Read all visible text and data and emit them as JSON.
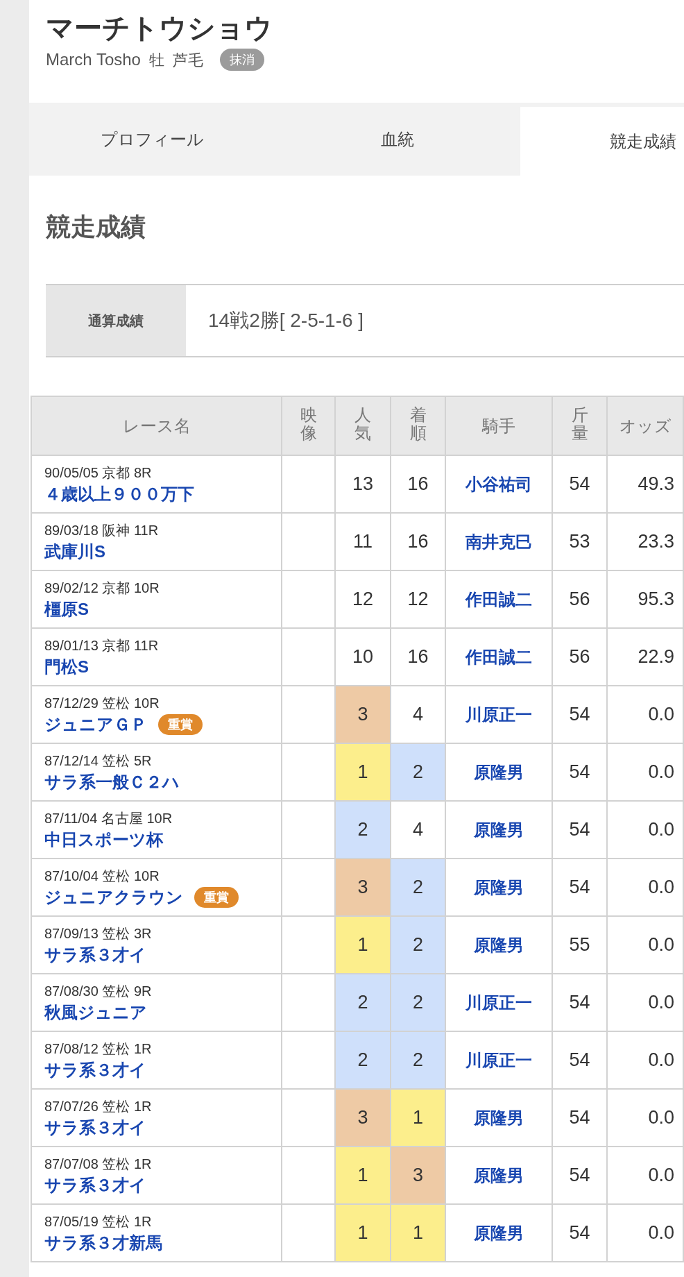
{
  "horse": {
    "name": "マーチトウショウ",
    "english_name": "March Tosho",
    "sex": "牡",
    "coat": "芦毛",
    "status_badge": "抹消"
  },
  "tabs": [
    {
      "label": "プロフィール",
      "selected": false
    },
    {
      "label": "血統",
      "selected": false
    },
    {
      "label": "競走成績",
      "selected": true
    }
  ],
  "section_title": "競走成績",
  "summary": {
    "label": "通算成績",
    "value": "14戦2勝[ 2-5-1-6 ]"
  },
  "table": {
    "columns": [
      {
        "label": "レース名",
        "kind": "inline"
      },
      {
        "label": "映像",
        "kind": "stacked"
      },
      {
        "label": "人気",
        "kind": "stacked"
      },
      {
        "label": "着順",
        "kind": "stacked"
      },
      {
        "label": "騎手",
        "kind": "inline"
      },
      {
        "label": "斤量",
        "kind": "stacked"
      },
      {
        "label": "オッズ",
        "kind": "inline"
      }
    ],
    "rows": [
      {
        "date_venue": "90/05/05 京都 8R",
        "race": "４歳以上９００万下",
        "popularity": {
          "text": "13"
        },
        "finish": {
          "text": "16"
        },
        "jockey": "小谷祐司",
        "weight": "54",
        "odds": "49.3"
      },
      {
        "date_venue": "89/03/18 阪神 11R",
        "race": "武庫川S",
        "popularity": {
          "text": "11"
        },
        "finish": {
          "text": "16"
        },
        "jockey": "南井克巳",
        "weight": "53",
        "odds": "23.3"
      },
      {
        "date_venue": "89/02/12 京都 10R",
        "race": "橿原S",
        "popularity": {
          "text": "12"
        },
        "finish": {
          "text": "12"
        },
        "jockey": "作田誠二",
        "weight": "56",
        "odds": "95.3"
      },
      {
        "date_venue": "89/01/13 京都 11R",
        "race": "門松S",
        "popularity": {
          "text": "10"
        },
        "finish": {
          "text": "16"
        },
        "jockey": "作田誠二",
        "weight": "56",
        "odds": "22.9"
      },
      {
        "date_venue": "87/12/29 笠松 10R",
        "race": "ジュニアＧＰ",
        "badge": "重賞",
        "popularity": {
          "text": "3",
          "color": "#eecaa5"
        },
        "finish": {
          "text": "4"
        },
        "jockey": "川原正一",
        "weight": "54",
        "odds": "0.0"
      },
      {
        "date_venue": "87/12/14 笠松 5R",
        "race": "サラ系一般Ｃ２ハ",
        "popularity": {
          "text": "1",
          "color": "#fcee8c"
        },
        "finish": {
          "text": "2",
          "color": "#cfe0fb"
        },
        "jockey": "原隆男",
        "weight": "54",
        "odds": "0.0"
      },
      {
        "date_venue": "87/11/04 名古屋 10R",
        "race": "中日スポーツ杯",
        "popularity": {
          "text": "2",
          "color": "#cfe0fb"
        },
        "finish": {
          "text": "4"
        },
        "jockey": "原隆男",
        "weight": "54",
        "odds": "0.0"
      },
      {
        "date_venue": "87/10/04 笠松 10R",
        "race": "ジュニアクラウン",
        "badge": "重賞",
        "popularity": {
          "text": "3",
          "color": "#eecaa5"
        },
        "finish": {
          "text": "2",
          "color": "#cfe0fb"
        },
        "jockey": "原隆男",
        "weight": "54",
        "odds": "0.0"
      },
      {
        "date_venue": "87/09/13 笠松 3R",
        "race": "サラ系３才イ",
        "popularity": {
          "text": "1",
          "color": "#fcee8c"
        },
        "finish": {
          "text": "2",
          "color": "#cfe0fb"
        },
        "jockey": "原隆男",
        "weight": "55",
        "odds": "0.0"
      },
      {
        "date_venue": "87/08/30 笠松 9R",
        "race": "秋風ジュニア",
        "popularity": {
          "text": "2",
          "color": "#cfe0fb"
        },
        "finish": {
          "text": "2",
          "color": "#cfe0fb"
        },
        "jockey": "川原正一",
        "weight": "54",
        "odds": "0.0"
      },
      {
        "date_venue": "87/08/12 笠松 1R",
        "race": "サラ系３才イ",
        "popularity": {
          "text": "2",
          "color": "#cfe0fb"
        },
        "finish": {
          "text": "2",
          "color": "#cfe0fb"
        },
        "jockey": "川原正一",
        "weight": "54",
        "odds": "0.0"
      },
      {
        "date_venue": "87/07/26 笠松 1R",
        "race": "サラ系３才イ",
        "popularity": {
          "text": "3",
          "color": "#eecaa5"
        },
        "finish": {
          "text": "1",
          "color": "#fcee8c"
        },
        "jockey": "原隆男",
        "weight": "54",
        "odds": "0.0"
      },
      {
        "date_venue": "87/07/08 笠松 1R",
        "race": "サラ系３才イ",
        "popularity": {
          "text": "1",
          "color": "#fcee8c"
        },
        "finish": {
          "text": "3",
          "color": "#eecaa5"
        },
        "jockey": "原隆男",
        "weight": "54",
        "odds": "0.0"
      },
      {
        "date_venue": "87/05/19 笠松 1R",
        "race": "サラ系３才新馬",
        "popularity": {
          "text": "1",
          "color": "#fcee8c"
        },
        "finish": {
          "text": "1",
          "color": "#fcee8c"
        },
        "jockey": "原隆男",
        "weight": "54",
        "odds": "0.0"
      }
    ]
  }
}
